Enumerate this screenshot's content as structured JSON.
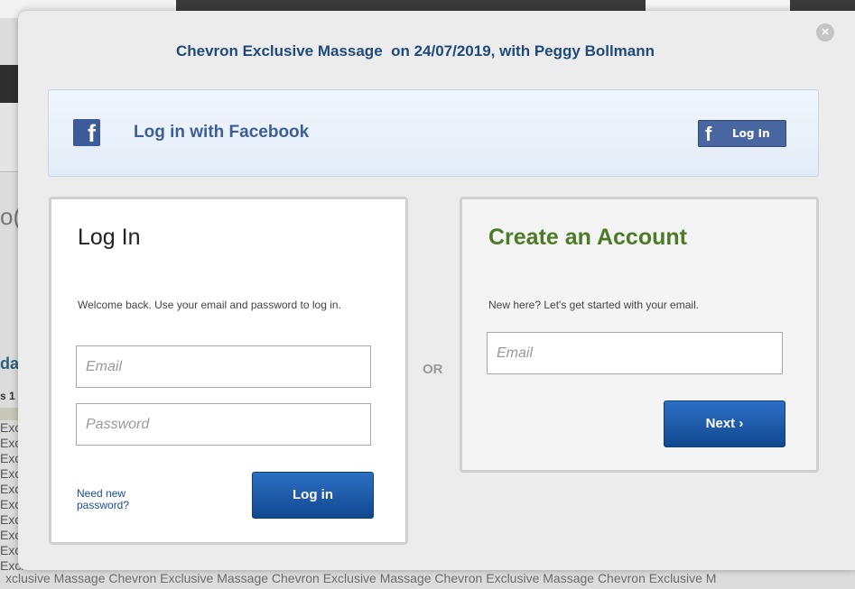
{
  "background": {
    "logo": "(((",
    "partial_text_oo": "o(",
    "partial_text_da": "da",
    "partial_text_s1": "s 1",
    "rows": [
      "Exclusive",
      "Exclusive",
      "Exclusive",
      "Exclusive",
      "Exclusive",
      "Exclusive",
      "Exclusive",
      "Exclusive",
      "Exclusive",
      "Exclusive"
    ],
    "footer_text": "xclusive Massage   Chevron Exclusive Massage   Chevron Exclusive Massage   Chevron Exclusive Massage   Chevron Exclusive M"
  },
  "modal": {
    "close_symbol": "×",
    "title": "Chevron Exclusive Massage  on 24/07/2019, with Peggy Bollmann",
    "facebook": {
      "icon_letter": "f",
      "label": "Log in with Facebook",
      "button_label": "Log In"
    },
    "login": {
      "heading": "Log In",
      "description": "Welcome back. Use your email and password to log in.",
      "email_placeholder": "Email",
      "password_placeholder": "Password",
      "forgot_link": "Need new password?",
      "submit_label": "Log in"
    },
    "or_label": "OR",
    "create": {
      "heading": "Create an Account",
      "description": "New here? Let's get started with your email.",
      "email_placeholder": "Email",
      "next_label": "Next ›"
    }
  }
}
